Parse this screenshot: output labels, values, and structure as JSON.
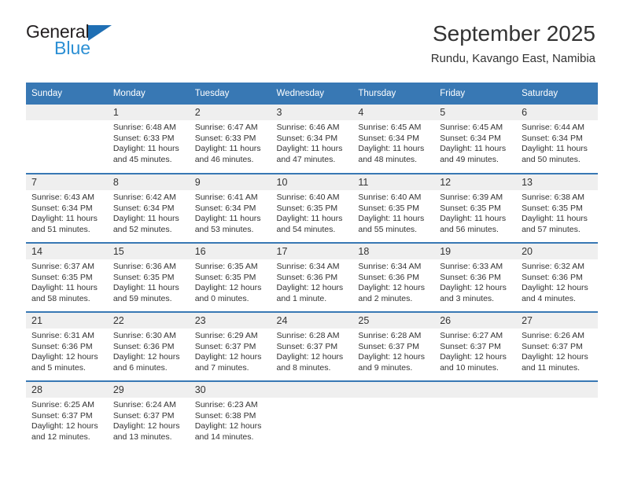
{
  "brand": {
    "name_part1": "General",
    "name_part2": "Blue",
    "accent_color": "#2b8fd4",
    "triangle_color": "#1f6fb4"
  },
  "header": {
    "title": "September 2025",
    "subtitle": "Rundu, Kavango East, Namibia"
  },
  "theme": {
    "header_bg": "#3878b4",
    "daynum_bg": "#efefef",
    "text_color": "#333333"
  },
  "weekday_headers": [
    "Sunday",
    "Monday",
    "Tuesday",
    "Wednesday",
    "Thursday",
    "Friday",
    "Saturday"
  ],
  "weeks": [
    [
      {
        "day": "",
        "sunrise": "",
        "sunset": "",
        "daylight1": "",
        "daylight2": ""
      },
      {
        "day": "1",
        "sunrise": "Sunrise: 6:48 AM",
        "sunset": "Sunset: 6:33 PM",
        "daylight1": "Daylight: 11 hours",
        "daylight2": "and 45 minutes."
      },
      {
        "day": "2",
        "sunrise": "Sunrise: 6:47 AM",
        "sunset": "Sunset: 6:33 PM",
        "daylight1": "Daylight: 11 hours",
        "daylight2": "and 46 minutes."
      },
      {
        "day": "3",
        "sunrise": "Sunrise: 6:46 AM",
        "sunset": "Sunset: 6:34 PM",
        "daylight1": "Daylight: 11 hours",
        "daylight2": "and 47 minutes."
      },
      {
        "day": "4",
        "sunrise": "Sunrise: 6:45 AM",
        "sunset": "Sunset: 6:34 PM",
        "daylight1": "Daylight: 11 hours",
        "daylight2": "and 48 minutes."
      },
      {
        "day": "5",
        "sunrise": "Sunrise: 6:45 AM",
        "sunset": "Sunset: 6:34 PM",
        "daylight1": "Daylight: 11 hours",
        "daylight2": "and 49 minutes."
      },
      {
        "day": "6",
        "sunrise": "Sunrise: 6:44 AM",
        "sunset": "Sunset: 6:34 PM",
        "daylight1": "Daylight: 11 hours",
        "daylight2": "and 50 minutes."
      }
    ],
    [
      {
        "day": "7",
        "sunrise": "Sunrise: 6:43 AM",
        "sunset": "Sunset: 6:34 PM",
        "daylight1": "Daylight: 11 hours",
        "daylight2": "and 51 minutes."
      },
      {
        "day": "8",
        "sunrise": "Sunrise: 6:42 AM",
        "sunset": "Sunset: 6:34 PM",
        "daylight1": "Daylight: 11 hours",
        "daylight2": "and 52 minutes."
      },
      {
        "day": "9",
        "sunrise": "Sunrise: 6:41 AM",
        "sunset": "Sunset: 6:34 PM",
        "daylight1": "Daylight: 11 hours",
        "daylight2": "and 53 minutes."
      },
      {
        "day": "10",
        "sunrise": "Sunrise: 6:40 AM",
        "sunset": "Sunset: 6:35 PM",
        "daylight1": "Daylight: 11 hours",
        "daylight2": "and 54 minutes."
      },
      {
        "day": "11",
        "sunrise": "Sunrise: 6:40 AM",
        "sunset": "Sunset: 6:35 PM",
        "daylight1": "Daylight: 11 hours",
        "daylight2": "and 55 minutes."
      },
      {
        "day": "12",
        "sunrise": "Sunrise: 6:39 AM",
        "sunset": "Sunset: 6:35 PM",
        "daylight1": "Daylight: 11 hours",
        "daylight2": "and 56 minutes."
      },
      {
        "day": "13",
        "sunrise": "Sunrise: 6:38 AM",
        "sunset": "Sunset: 6:35 PM",
        "daylight1": "Daylight: 11 hours",
        "daylight2": "and 57 minutes."
      }
    ],
    [
      {
        "day": "14",
        "sunrise": "Sunrise: 6:37 AM",
        "sunset": "Sunset: 6:35 PM",
        "daylight1": "Daylight: 11 hours",
        "daylight2": "and 58 minutes."
      },
      {
        "day": "15",
        "sunrise": "Sunrise: 6:36 AM",
        "sunset": "Sunset: 6:35 PM",
        "daylight1": "Daylight: 11 hours",
        "daylight2": "and 59 minutes."
      },
      {
        "day": "16",
        "sunrise": "Sunrise: 6:35 AM",
        "sunset": "Sunset: 6:35 PM",
        "daylight1": "Daylight: 12 hours",
        "daylight2": "and 0 minutes."
      },
      {
        "day": "17",
        "sunrise": "Sunrise: 6:34 AM",
        "sunset": "Sunset: 6:36 PM",
        "daylight1": "Daylight: 12 hours",
        "daylight2": "and 1 minute."
      },
      {
        "day": "18",
        "sunrise": "Sunrise: 6:34 AM",
        "sunset": "Sunset: 6:36 PM",
        "daylight1": "Daylight: 12 hours",
        "daylight2": "and 2 minutes."
      },
      {
        "day": "19",
        "sunrise": "Sunrise: 6:33 AM",
        "sunset": "Sunset: 6:36 PM",
        "daylight1": "Daylight: 12 hours",
        "daylight2": "and 3 minutes."
      },
      {
        "day": "20",
        "sunrise": "Sunrise: 6:32 AM",
        "sunset": "Sunset: 6:36 PM",
        "daylight1": "Daylight: 12 hours",
        "daylight2": "and 4 minutes."
      }
    ],
    [
      {
        "day": "21",
        "sunrise": "Sunrise: 6:31 AM",
        "sunset": "Sunset: 6:36 PM",
        "daylight1": "Daylight: 12 hours",
        "daylight2": "and 5 minutes."
      },
      {
        "day": "22",
        "sunrise": "Sunrise: 6:30 AM",
        "sunset": "Sunset: 6:36 PM",
        "daylight1": "Daylight: 12 hours",
        "daylight2": "and 6 minutes."
      },
      {
        "day": "23",
        "sunrise": "Sunrise: 6:29 AM",
        "sunset": "Sunset: 6:37 PM",
        "daylight1": "Daylight: 12 hours",
        "daylight2": "and 7 minutes."
      },
      {
        "day": "24",
        "sunrise": "Sunrise: 6:28 AM",
        "sunset": "Sunset: 6:37 PM",
        "daylight1": "Daylight: 12 hours",
        "daylight2": "and 8 minutes."
      },
      {
        "day": "25",
        "sunrise": "Sunrise: 6:28 AM",
        "sunset": "Sunset: 6:37 PM",
        "daylight1": "Daylight: 12 hours",
        "daylight2": "and 9 minutes."
      },
      {
        "day": "26",
        "sunrise": "Sunrise: 6:27 AM",
        "sunset": "Sunset: 6:37 PM",
        "daylight1": "Daylight: 12 hours",
        "daylight2": "and 10 minutes."
      },
      {
        "day": "27",
        "sunrise": "Sunrise: 6:26 AM",
        "sunset": "Sunset: 6:37 PM",
        "daylight1": "Daylight: 12 hours",
        "daylight2": "and 11 minutes."
      }
    ],
    [
      {
        "day": "28",
        "sunrise": "Sunrise: 6:25 AM",
        "sunset": "Sunset: 6:37 PM",
        "daylight1": "Daylight: 12 hours",
        "daylight2": "and 12 minutes."
      },
      {
        "day": "29",
        "sunrise": "Sunrise: 6:24 AM",
        "sunset": "Sunset: 6:37 PM",
        "daylight1": "Daylight: 12 hours",
        "daylight2": "and 13 minutes."
      },
      {
        "day": "30",
        "sunrise": "Sunrise: 6:23 AM",
        "sunset": "Sunset: 6:38 PM",
        "daylight1": "Daylight: 12 hours",
        "daylight2": "and 14 minutes."
      },
      {
        "day": "",
        "sunrise": "",
        "sunset": "",
        "daylight1": "",
        "daylight2": ""
      },
      {
        "day": "",
        "sunrise": "",
        "sunset": "",
        "daylight1": "",
        "daylight2": ""
      },
      {
        "day": "",
        "sunrise": "",
        "sunset": "",
        "daylight1": "",
        "daylight2": ""
      },
      {
        "day": "",
        "sunrise": "",
        "sunset": "",
        "daylight1": "",
        "daylight2": ""
      }
    ]
  ]
}
